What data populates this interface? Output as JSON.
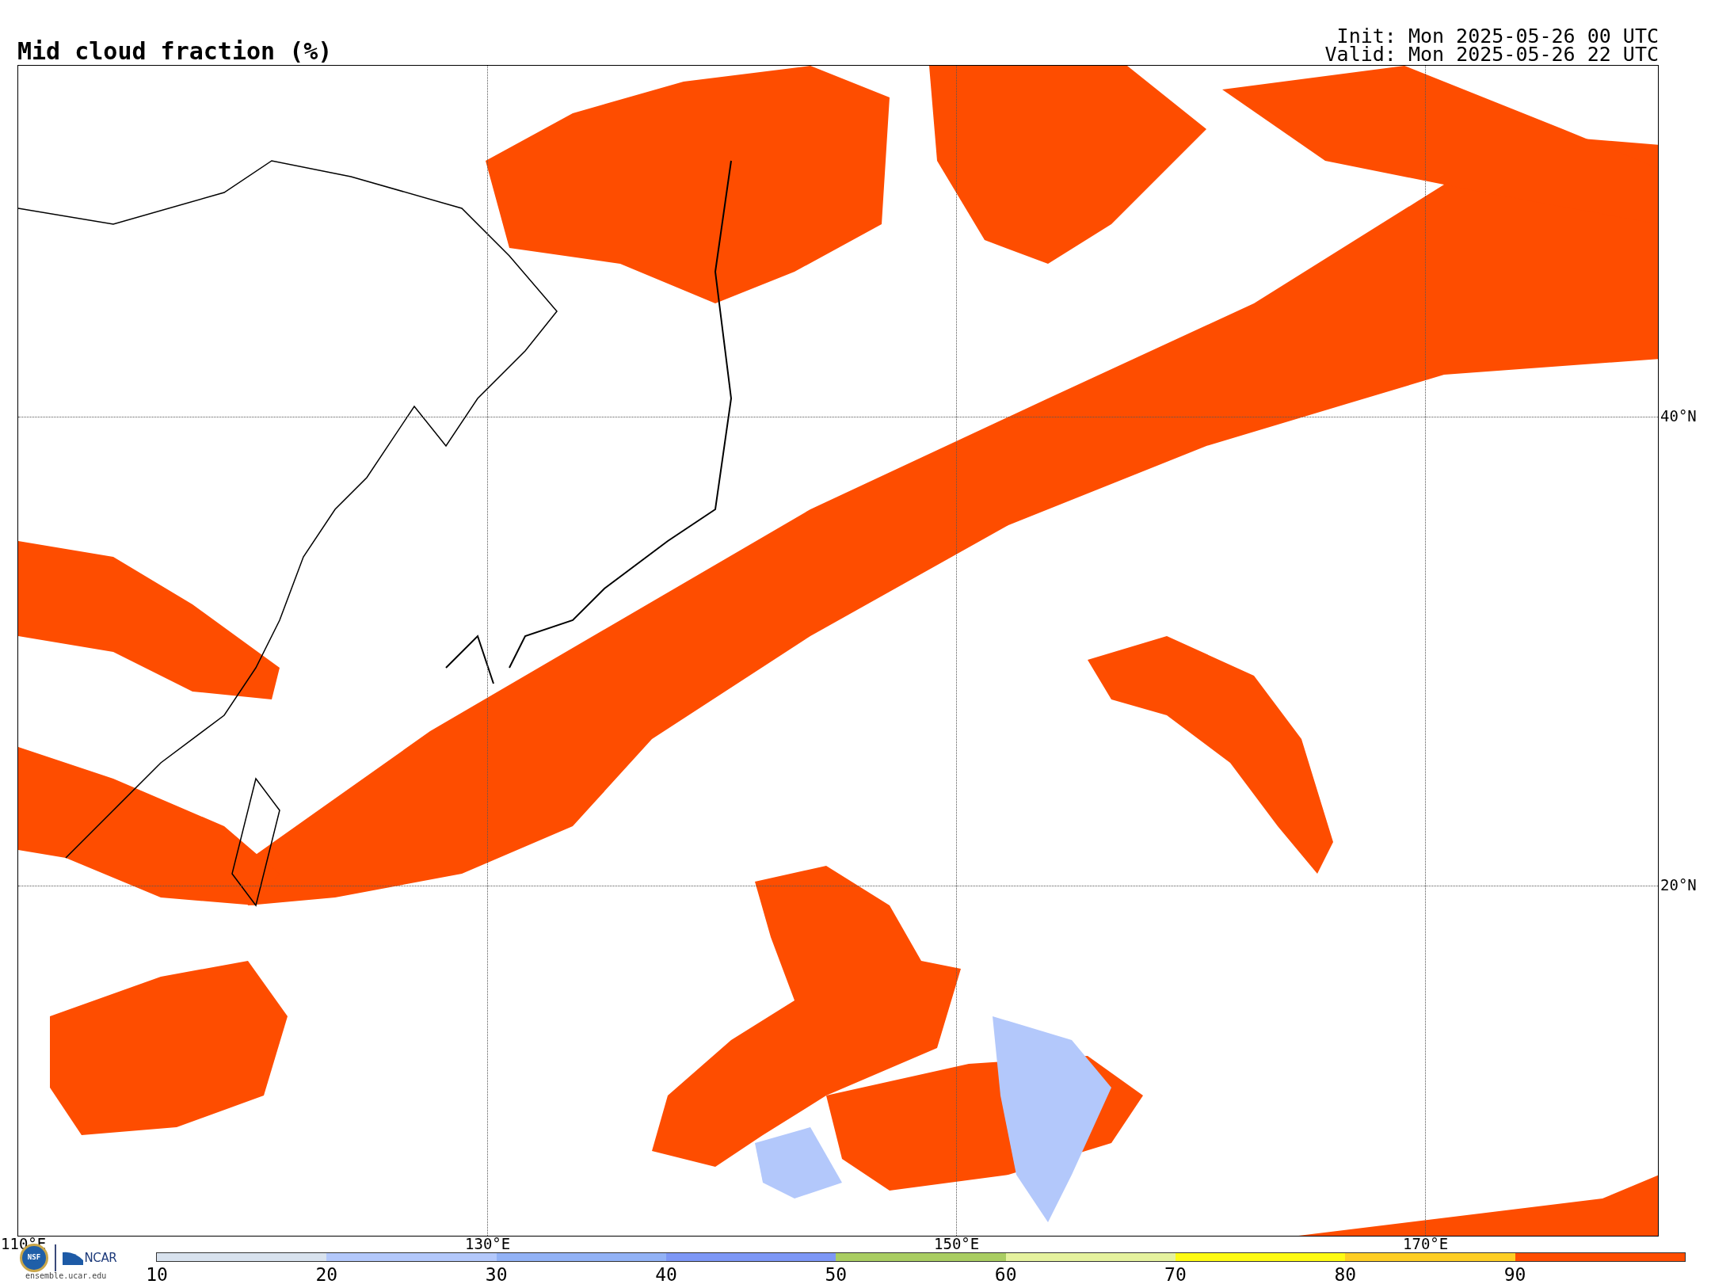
{
  "title": "Mid cloud fraction (%)",
  "init": "Init: Mon 2025-05-26 00 UTC",
  "valid": "Valid: Mon 2025-05-26 22 UTC",
  "map": {
    "lon_labels": [
      "110°E",
      "130°E",
      "150°E",
      "170°E"
    ],
    "lat_labels": [
      "40°N",
      "20°N"
    ]
  },
  "logos": {
    "nsf": "NSF",
    "ncar": "NCAR",
    "url": "ensemble.ucar.edu"
  },
  "colorbar": [
    {
      "label": "10",
      "color": "#d8e2ee"
    },
    {
      "label": "20",
      "color": "#b3c8fb"
    },
    {
      "label": "30",
      "color": "#92b2f6"
    },
    {
      "label": "40",
      "color": "#7d97f6"
    },
    {
      "label": "50",
      "color": "#a9cd62"
    },
    {
      "label": "60",
      "color": "#e5f29e"
    },
    {
      "label": "70",
      "color": "#fefb14"
    },
    {
      "label": "80",
      "color": "#fece24"
    },
    {
      "label": "90",
      "color": "#fe4d00"
    }
  ]
}
